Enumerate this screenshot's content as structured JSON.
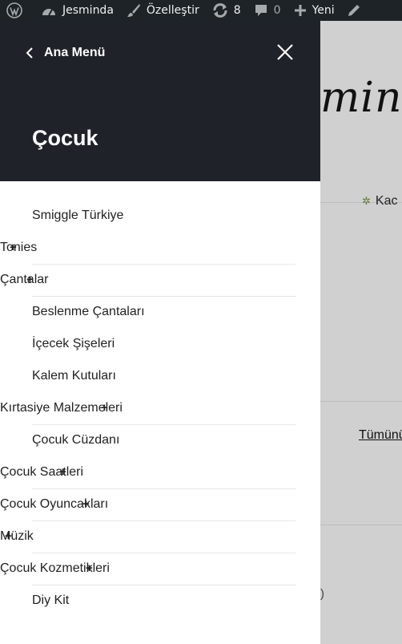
{
  "admin_bar": {
    "site_name": "Jesminda",
    "customize": "Özelleştir",
    "updates_count": "8",
    "comments_count": "0",
    "new_label": "Yeni"
  },
  "background_page": {
    "logo_text": "minda",
    "nav_text": "Kac",
    "link_text": "Tümünü",
    "fragment": ")"
  },
  "drawer": {
    "back_label": "Ana Menü",
    "title": "Çocuk",
    "items": [
      {
        "label": "Smiggle Türkiye",
        "level": "sub"
      },
      {
        "label": "Tonies",
        "level": "top",
        "expandable": true
      },
      {
        "label": "Çantalar",
        "level": "top",
        "expandable": true
      },
      {
        "label": "Beslenme Çantaları",
        "level": "sub"
      },
      {
        "label": "İçecek Şişeleri",
        "level": "sub"
      },
      {
        "label": "Kalem Kutuları",
        "level": "sub"
      },
      {
        "label": "Kırtasiye Malzemeleri",
        "level": "top",
        "expandable": true
      },
      {
        "label": "Çocuk Cüzdanı",
        "level": "sub"
      },
      {
        "label": "Çocuk Saatleri",
        "level": "top",
        "expandable": true
      },
      {
        "label": "Çocuk Oyuncakları",
        "level": "top",
        "expandable": true
      },
      {
        "label": "Müzik",
        "level": "top",
        "expandable": true
      },
      {
        "label": "Çocuk Kozmetikleri",
        "level": "top",
        "expandable": true
      },
      {
        "label": "Diy Kit",
        "level": "sub"
      }
    ]
  },
  "icons": [
    "wordpress-icon",
    "dashboard-icon",
    "brush-icon",
    "updates-icon",
    "comment-icon",
    "plus-icon",
    "pencil-icon",
    "chevron-left-icon",
    "close-icon",
    "expand-plus-icon"
  ],
  "colors": {
    "admin_bar": "#1d2327",
    "drawer_header": "#1f2228",
    "overlay": "#d0d0d0"
  }
}
